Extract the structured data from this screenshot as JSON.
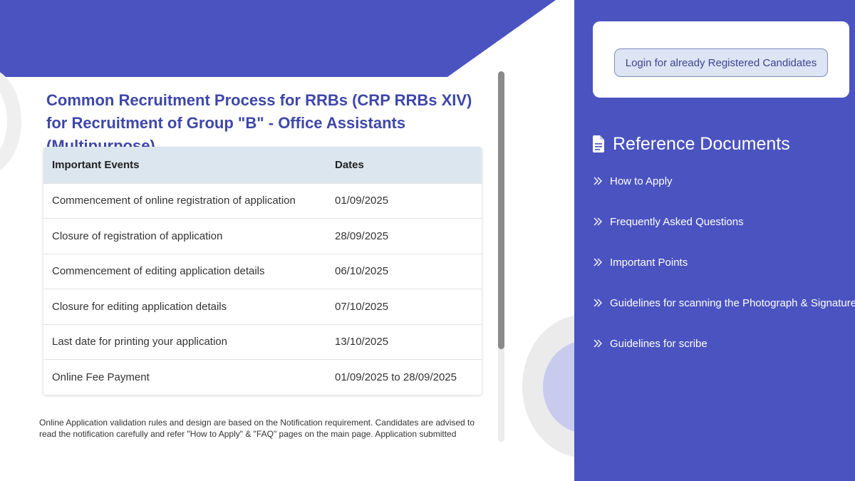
{
  "main": {
    "title": "Common Recruitment Process for RRBs (CRP RRBs XIV) for Recruitment of Group \"B\" - Office Assistants (Multipurpose)",
    "table": {
      "headers": [
        "Important Events",
        "Dates"
      ],
      "rows": [
        [
          "Commencement of online registration of application",
          "01/09/2025"
        ],
        [
          "Closure of registration of application",
          "28/09/2025"
        ],
        [
          "Commencement of editing application details",
          "06/10/2025"
        ],
        [
          "Closure for editing application details",
          "07/10/2025"
        ],
        [
          "Last date for printing your application",
          "13/10/2025"
        ],
        [
          "Online Fee Payment",
          "01/09/2025 to 28/09/2025"
        ]
      ]
    },
    "note": "Online Application validation rules and design are based on the Notification requirement. Candidates are advised to read the notification carefully and refer \"How to Apply\" & \"FAQ\" pages on the main page. Application submitted"
  },
  "sidebar": {
    "login_button": "Login for already Registered Candidates",
    "reference_title": "Reference Documents",
    "reference_icon": "document-icon",
    "items": [
      {
        "label": "How to Apply",
        "icon": "double-chevron-right-icon"
      },
      {
        "label": "Frequently Asked Questions",
        "icon": "double-chevron-right-icon"
      },
      {
        "label": "Important Points",
        "icon": "double-chevron-right-icon"
      },
      {
        "label": "Guidelines for scanning the Photograph & Signature",
        "icon": "double-chevron-right-icon"
      },
      {
        "label": "Guidelines for scribe",
        "icon": "double-chevron-right-icon"
      }
    ]
  },
  "colors": {
    "brand": "#4a53bf",
    "title": "#3e47a9",
    "table_header": "#dce6ef"
  }
}
